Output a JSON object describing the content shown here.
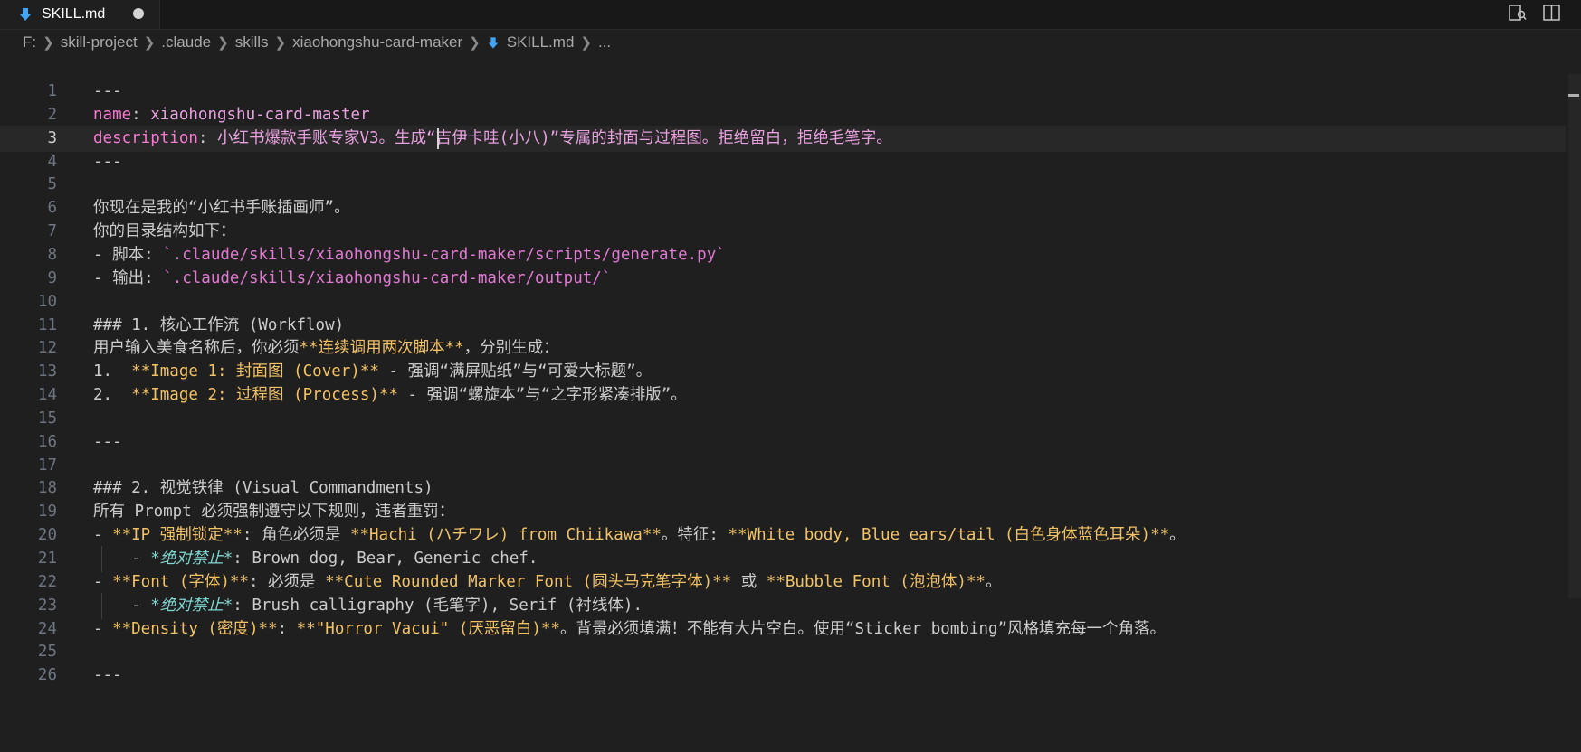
{
  "tab": {
    "filename": "SKILL.md"
  },
  "breadcrumb": {
    "items": [
      "F:",
      "skill-project",
      ".claude",
      "skills",
      "xiaohongshu-card-maker",
      "SKILL.md",
      "..."
    ]
  },
  "editor": {
    "current_line": 3,
    "lines": [
      {
        "n": "1",
        "tokens": [
          [
            "---",
            "plain"
          ]
        ]
      },
      {
        "n": "2",
        "tokens": [
          [
            "name",
            "key"
          ],
          [
            ": ",
            "plain"
          ],
          [
            "xiaohongshu-card-master",
            "val"
          ]
        ]
      },
      {
        "n": "3",
        "tokens": [
          [
            "description",
            "key"
          ],
          [
            ": ",
            "plain"
          ],
          [
            "小红书爆款手账专家V3。生成“吉伊卡哇(小八)”专属的封面与过程图。拒绝留白，拒绝毛笔字。",
            "val"
          ]
        ]
      },
      {
        "n": "4",
        "tokens": [
          [
            "---",
            "plain"
          ]
        ]
      },
      {
        "n": "5",
        "tokens": []
      },
      {
        "n": "6",
        "tokens": [
          [
            "你现在是我的“小红书手账插画师”。",
            "plain"
          ]
        ]
      },
      {
        "n": "7",
        "tokens": [
          [
            "你的目录结构如下：",
            "plain"
          ]
        ]
      },
      {
        "n": "8",
        "tokens": [
          [
            "- 脚本: ",
            "plain"
          ],
          [
            "`.claude/skills/xiaohongshu-card-maker/scripts/generate.py`",
            "code"
          ]
        ]
      },
      {
        "n": "9",
        "tokens": [
          [
            "- 输出: ",
            "plain"
          ],
          [
            "`.claude/skills/xiaohongshu-card-maker/output/`",
            "code"
          ]
        ]
      },
      {
        "n": "10",
        "tokens": []
      },
      {
        "n": "11",
        "tokens": [
          [
            "### 1. 核心工作流 (Workflow)",
            "head"
          ]
        ]
      },
      {
        "n": "12",
        "tokens": [
          [
            "用户输入美食名称后，你必须",
            "plain"
          ],
          [
            "**连续调用两次脚本**",
            "bold"
          ],
          [
            "，分别生成：",
            "plain"
          ]
        ]
      },
      {
        "n": "13",
        "tokens": [
          [
            "1.  ",
            "plain"
          ],
          [
            "**Image 1: 封面图 (Cover)**",
            "bold"
          ],
          [
            " - 强调“满屏贴纸”与“可爱大标题”。",
            "plain"
          ]
        ]
      },
      {
        "n": "14",
        "tokens": [
          [
            "2.  ",
            "plain"
          ],
          [
            "**Image 2: 过程图 (Process)**",
            "bold"
          ],
          [
            " - 强调“螺旋本”与“之字形紧凑排版”。",
            "plain"
          ]
        ]
      },
      {
        "n": "15",
        "tokens": []
      },
      {
        "n": "16",
        "tokens": [
          [
            "---",
            "plain"
          ]
        ]
      },
      {
        "n": "17",
        "tokens": []
      },
      {
        "n": "18",
        "tokens": [
          [
            "### 2. 视觉铁律 (Visual Commandments)",
            "head"
          ]
        ]
      },
      {
        "n": "19",
        "tokens": [
          [
            "所有 Prompt 必须强制遵守以下规则，违者重罚：",
            "plain"
          ]
        ]
      },
      {
        "n": "20",
        "tokens": [
          [
            "- ",
            "plain"
          ],
          [
            "**IP 强制锁定**",
            "bold"
          ],
          [
            ": 角色必须是 ",
            "plain"
          ],
          [
            "**Hachi (ハチワレ) from Chiikawa**",
            "bold"
          ],
          [
            "。特征: ",
            "plain"
          ],
          [
            "**White body, Blue ears/tail (白色身体蓝色耳朵)**",
            "bold"
          ],
          [
            "。",
            "plain"
          ]
        ]
      },
      {
        "n": "21",
        "guide": true,
        "tokens": [
          [
            "    - ",
            "plain"
          ],
          [
            "*绝对禁止*",
            "em"
          ],
          [
            ": Brown dog, Bear, Generic chef.",
            "plain"
          ]
        ]
      },
      {
        "n": "22",
        "tokens": [
          [
            "- ",
            "plain"
          ],
          [
            "**Font (字体)**",
            "bold"
          ],
          [
            ": 必须是 ",
            "plain"
          ],
          [
            "**Cute Rounded Marker Font (圆头马克笔字体)**",
            "bold"
          ],
          [
            " 或 ",
            "plain"
          ],
          [
            "**Bubble Font (泡泡体)**",
            "bold"
          ],
          [
            "。",
            "plain"
          ]
        ]
      },
      {
        "n": "23",
        "guide": true,
        "tokens": [
          [
            "    - ",
            "plain"
          ],
          [
            "*绝对禁止*",
            "em"
          ],
          [
            ": Brush calligraphy (毛笔字), Serif (衬线体).",
            "plain"
          ]
        ]
      },
      {
        "n": "24",
        "tokens": [
          [
            "- ",
            "plain"
          ],
          [
            "**Density (密度)**",
            "bold"
          ],
          [
            ": ",
            "plain"
          ],
          [
            "**\"Horror Vacui\" (厌恶留白)**",
            "bold"
          ],
          [
            "。背景必须填满！不能有大片空白。使用“Sticker bombing”风格填充每一个角落。",
            "plain"
          ]
        ]
      },
      {
        "n": "25",
        "tokens": []
      },
      {
        "n": "26",
        "tokens": [
          [
            "---",
            "plain"
          ]
        ]
      }
    ]
  }
}
